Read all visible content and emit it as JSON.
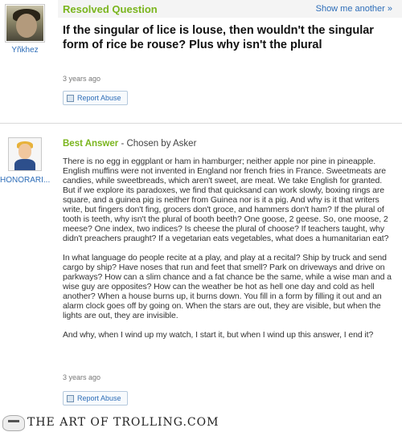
{
  "question": {
    "status": "Resolved Question",
    "show_more": "Show me another »",
    "asker": "Yñkhez",
    "title": "If the singular of lice is louse, then wouldn't the singular form of rice be rouse? Plus why isn't the plural",
    "time": "3 years ago",
    "report_label": "Report Abuse"
  },
  "answer": {
    "user": "HONORARI...",
    "best_label": "Best Answer",
    "chosen": " - Chosen by Asker",
    "paragraphs": [
      "There is no egg in eggplant or ham in hamburger; neither apple nor pine in pineapple. English muffins were not invented in England nor french fries in France. Sweetmeats are candies, while sweetbreads, which aren't sweet, are meat. We take English for granted. But if we explore its paradoxes, we find that quicksand can work slowly, boxing rings are square, and a guinea pig is neither from Guinea nor is it a pig. And why is it that writers write, but fingers don't fing, grocers don't groce, and hammers don't ham? If the plural of tooth is teeth, why isn't the plural of booth beeth? One goose, 2 geese. So, one moose, 2 meese? One index, two indices? Is cheese the plural of choose? If teachers taught, why didn't preachers praught? If a vegetarian eats vegetables, what does a humanitarian eat?",
      "In what language do people recite at a play, and play at a recital? Ship by truck and send cargo by ship? Have noses that run and feet that smell? Park on driveways and drive on parkways? How can a slim chance and a fat chance be the same, while a wise man and a wise guy are opposites? How can the weather be hot as hell one day and cold as hell another? When a house burns up, it burns down. You fill in a form by filling it out and an alarm clock goes off by going on. When the stars are out, they are visible, but when the lights are out, they are invisible.",
      "And why, when I wind up my watch, I start it, but when I wind up this answer, I end it?"
    ],
    "time": "3 years ago",
    "report_label": "Report Abuse"
  },
  "watermark": "THE ART OF TROLLING.COM",
  "colors": {
    "accent_green": "#7ab51d",
    "link_blue": "#2d6db8"
  },
  "icons": [
    "report-flag-icon",
    "chevron-right-icon",
    "watermark-mask-icon"
  ]
}
